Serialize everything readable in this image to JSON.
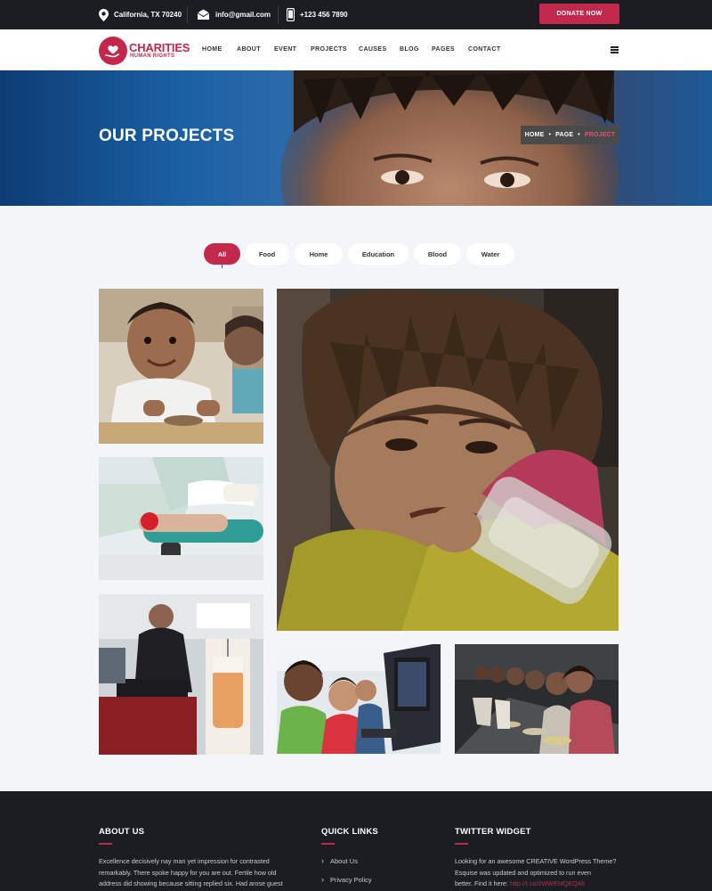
{
  "topbar": {
    "address": "California, TX 70240",
    "email": "info@gmail.com",
    "phone": "+123 456 7890",
    "donate_label": "DONATE NOW"
  },
  "brand": {
    "name": "CHARITIES",
    "tagline": "HUMAN RIGHTS",
    "accent": "#c2274c",
    "dark": "#1b1d22"
  },
  "nav": {
    "items": [
      "HOME",
      "ABOUT",
      "EVENT",
      "PROJECTS",
      "CAUSES",
      "BLOG",
      "PAGES",
      "CONTACT"
    ]
  },
  "hero": {
    "title": "OUR PROJECTS",
    "breadcrumb": [
      "HOME",
      "PAGE",
      "PROJECT"
    ]
  },
  "filters": {
    "items": [
      "All",
      "Food",
      "Home",
      "Education",
      "Blood",
      "Water"
    ],
    "selected": "All"
  },
  "gallery": {
    "photos": [
      "smiling-boy-photo",
      "blood-donation-photo",
      "blood-drive-photo",
      "crying-child-photo",
      "kids-computers-photo",
      "children-eating-photo"
    ]
  },
  "footer": {
    "about": {
      "title": "ABOUT US",
      "lines": [
        "Excellence decisively nay man yet impression for contrasted",
        "remarkably. There spoke happy for you are out. Fertile how old",
        "address did showing because sitting replied six. Had arose guest"
      ]
    },
    "links": {
      "title": "QUICK LINKS",
      "items": [
        "About Us",
        "Privacy Policy"
      ]
    },
    "twitter": {
      "title": "TWITTER WIDGET",
      "lines": [
        "Looking for an awesome CREATIVE WordPress Theme?",
        "Esquise was updated and optimized to run even"
      ],
      "last_prefix": "better. Find it here:",
      "link": "http://t.co/0WWEMQEQ48"
    }
  }
}
